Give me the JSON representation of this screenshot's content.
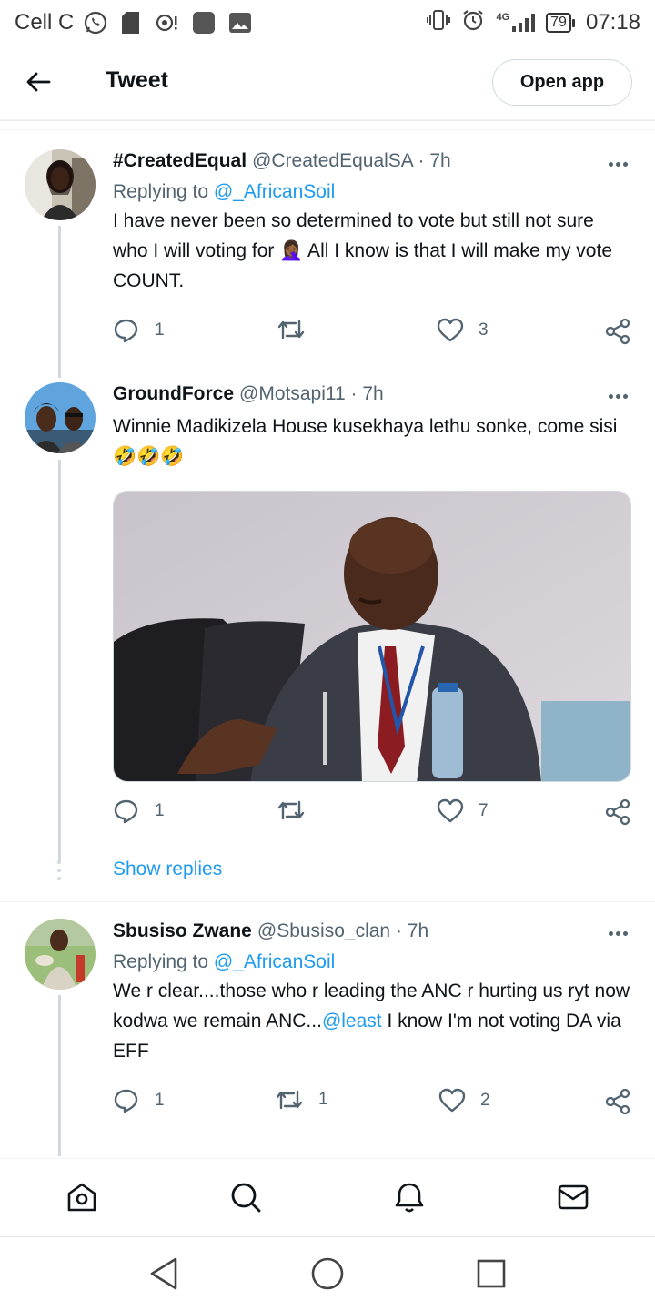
{
  "status_bar": {
    "carrier": "Cell C",
    "network": "4G",
    "battery": "79",
    "time": "07:18"
  },
  "app_bar": {
    "title": "Tweet",
    "open_app_label": "Open app"
  },
  "tweets": [
    {
      "name": "#CreatedEqual",
      "handle": "@CreatedEqualSA · 7h",
      "replying_prefix": "Replying to",
      "replying_to": "@_AfricanSoil",
      "text": "I have never been so determined to vote but still not sure who I will voting for 🤦🏾‍♀️ All I know is that I will make my vote COUNT.",
      "replies": "1",
      "retweets": "",
      "likes": "3"
    },
    {
      "name": "GroundForce",
      "handle": "@Motsapi11 · 7h",
      "text": "Winnie Madikizela House kusekhaya lethu sonke, come sisi 🤣🤣🤣",
      "replies": "1",
      "retweets": "",
      "likes": "7",
      "show_replies_label": "Show replies"
    },
    {
      "name": "Sbusiso Zwane",
      "handle": "@Sbusiso_clan · 7h",
      "replying_prefix": "Replying to",
      "replying_to": "@_AfricanSoil",
      "text_before": "We r clear....those who r leading the ANC r hurting us ryt now kodwa we remain ANC...",
      "text_mention": "@least",
      "text_after": " I know I'm not voting DA via EFF",
      "replies": "1",
      "retweets": "1",
      "likes": "2"
    }
  ],
  "colors": {
    "accent": "#1d9bf0",
    "text": "#0f1419",
    "muted": "#536471",
    "border": "#cfd9de"
  },
  "icons": {
    "nav": [
      "home-icon",
      "search-icon",
      "notifications-icon",
      "messages-icon"
    ],
    "system": [
      "back-triangle-icon",
      "home-circle-icon",
      "recents-square-icon"
    ]
  }
}
